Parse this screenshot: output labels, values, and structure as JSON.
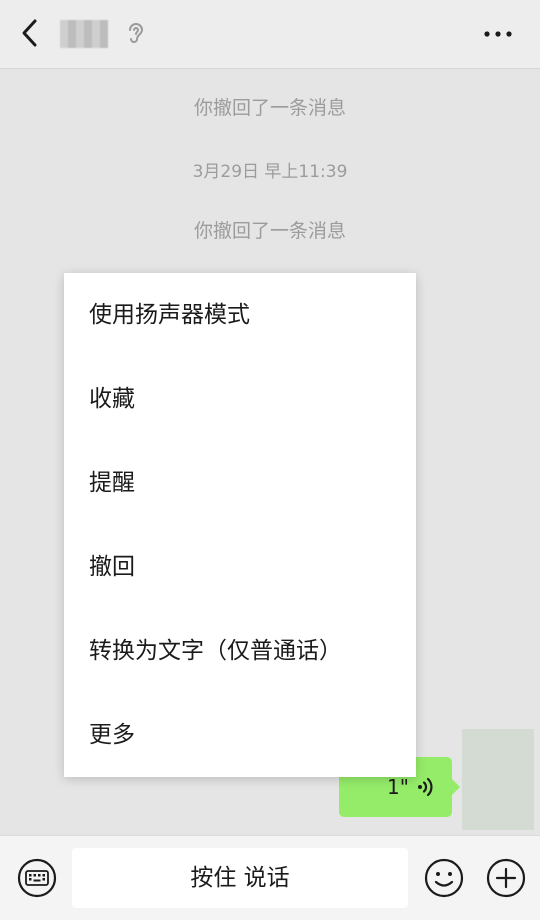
{
  "header": {
    "back_icon": "back-chevron-icon",
    "contact_name": "",
    "status_icon": "earpiece-mode-icon",
    "more_icon": "more-dots-icon"
  },
  "chat": {
    "recall_notice_1": "你撤回了一条消息",
    "timestamp": "3月29日 早上11:39",
    "recall_notice_2": "你撤回了一条消息",
    "voice_message": {
      "duration": "1\"",
      "bubble_color": "#95ec69"
    }
  },
  "context_menu": {
    "items": [
      {
        "label": "使用扬声器模式"
      },
      {
        "label": "收藏"
      },
      {
        "label": "提醒"
      },
      {
        "label": "撤回"
      },
      {
        "label": "转换为文字（仅普通话）"
      },
      {
        "label": "更多"
      }
    ]
  },
  "input_bar": {
    "hold_to_talk_label": "按住 说话",
    "keyboard_icon": "keyboard-icon",
    "emoji_icon": "emoji-icon",
    "plus_icon": "plus-icon"
  }
}
